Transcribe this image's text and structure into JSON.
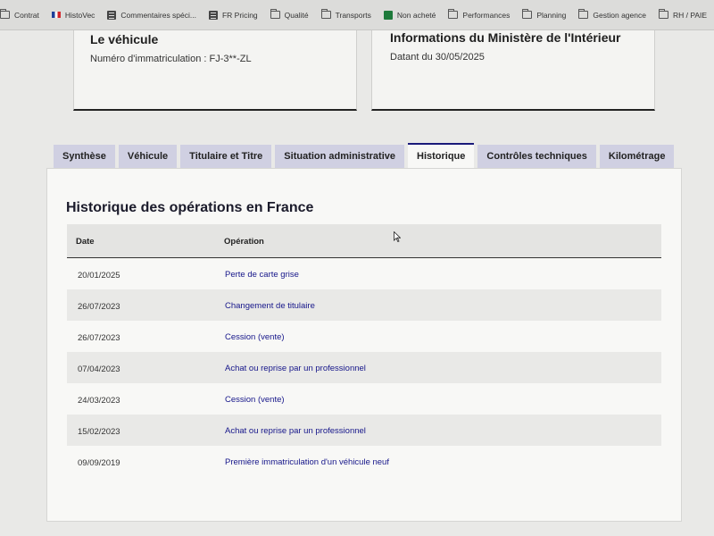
{
  "bookmarks": [
    {
      "label": "Contrat",
      "icon": "folder-icon"
    },
    {
      "label": "HistoVec",
      "icon": "flag-icon"
    },
    {
      "label": "Commentaires spéci...",
      "icon": "document-icon"
    },
    {
      "label": "FR Pricing",
      "icon": "document-icon"
    },
    {
      "label": "Qualité",
      "icon": "folder-icon"
    },
    {
      "label": "Transports",
      "icon": "folder-icon"
    },
    {
      "label": "Non acheté",
      "icon": "sheet-icon"
    },
    {
      "label": "Performances",
      "icon": "folder-icon"
    },
    {
      "label": "Planning",
      "icon": "folder-icon"
    },
    {
      "label": "Gestion agence",
      "icon": "folder-icon"
    },
    {
      "label": "RH / PAIE",
      "icon": "folder-icon"
    }
  ],
  "vehicle_card": {
    "title": "Le véhicule",
    "plate_text": "Numéro d'immatriculation : FJ-3**-ZL"
  },
  "ministry_card": {
    "title": "Informations du Ministère de l'Intérieur",
    "date_text": "Datant du 30/05/2025"
  },
  "tabs": [
    {
      "label": "Synthèse",
      "active": false
    },
    {
      "label": "Véhicule",
      "active": false
    },
    {
      "label": "Titulaire et Titre",
      "active": false
    },
    {
      "label": "Situation administrative",
      "active": false
    },
    {
      "label": "Historique",
      "active": true
    },
    {
      "label": "Contrôles techniques",
      "active": false
    },
    {
      "label": "Kilométrage",
      "active": false
    }
  ],
  "history": {
    "title": "Historique des opérations en France",
    "columns": {
      "date": "Date",
      "operation": "Opération"
    },
    "rows": [
      {
        "date": "20/01/2025",
        "operation": "Perte de carte grise"
      },
      {
        "date": "26/07/2023",
        "operation": "Changement de titulaire"
      },
      {
        "date": "26/07/2023",
        "operation": "Cession (vente)"
      },
      {
        "date": "07/04/2023",
        "operation": "Achat ou reprise par un professionnel"
      },
      {
        "date": "24/03/2023",
        "operation": "Cession (vente)"
      },
      {
        "date": "15/02/2023",
        "operation": "Achat ou reprise par un professionnel"
      },
      {
        "date": "09/09/2019",
        "operation": "Première immatriculation d'un véhicule neuf"
      }
    ]
  },
  "colors": {
    "active_tab_border": "#1a1a7a",
    "tab_bg": "#d0d0e2",
    "operation_link": "#16168a"
  }
}
